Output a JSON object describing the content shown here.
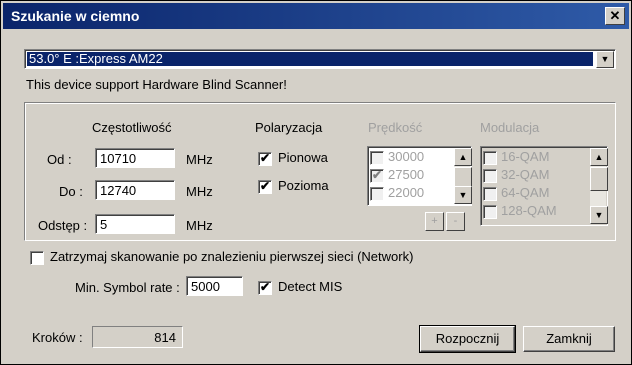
{
  "window": {
    "title": "Szukanie w ciemno",
    "close_symbol": "✕"
  },
  "satellite": {
    "selected": "53.0° E :Express AM22"
  },
  "info_text": "This device support Hardware Blind Scanner!",
  "frequency": {
    "header": "Częstotliwość",
    "from_label": "Od :",
    "from_value": "10710",
    "to_label": "Do :",
    "to_value": "12740",
    "step_label": "Odstęp :",
    "step_value": "5",
    "unit": "MHz"
  },
  "polarization": {
    "header": "Polaryzacja",
    "items": [
      {
        "label": "Pionowa",
        "checked": true
      },
      {
        "label": "Pozioma",
        "checked": true
      }
    ]
  },
  "speed": {
    "header": "Prędkość",
    "items": [
      {
        "label": "30000",
        "checked": false
      },
      {
        "label": "27500",
        "checked": true
      },
      {
        "label": "22000",
        "checked": false
      }
    ],
    "add_symbol": "+",
    "remove_symbol": "-"
  },
  "modulation": {
    "header": "Modulacja",
    "items": [
      {
        "label": "16-QAM",
        "checked": false
      },
      {
        "label": "32-QAM",
        "checked": false
      },
      {
        "label": "64-QAM",
        "checked": false
      },
      {
        "label": "128-QAM",
        "checked": false
      }
    ]
  },
  "stop_on_first": {
    "label": "Zatrzymaj skanowanie po znalezieniu pierwszej sieci (Network)",
    "checked": false
  },
  "min_symbol_rate": {
    "label": "Min. Symbol rate :",
    "value": "5000"
  },
  "detect_mis": {
    "label": "Detect MIS",
    "checked": true
  },
  "steps": {
    "label": "Kroków :",
    "value": "814"
  },
  "buttons": {
    "start": "Rozpocznij",
    "close": "Zamknij"
  },
  "icons": {
    "scroll_up": "▲",
    "scroll_down": "▼",
    "check": "✔"
  }
}
